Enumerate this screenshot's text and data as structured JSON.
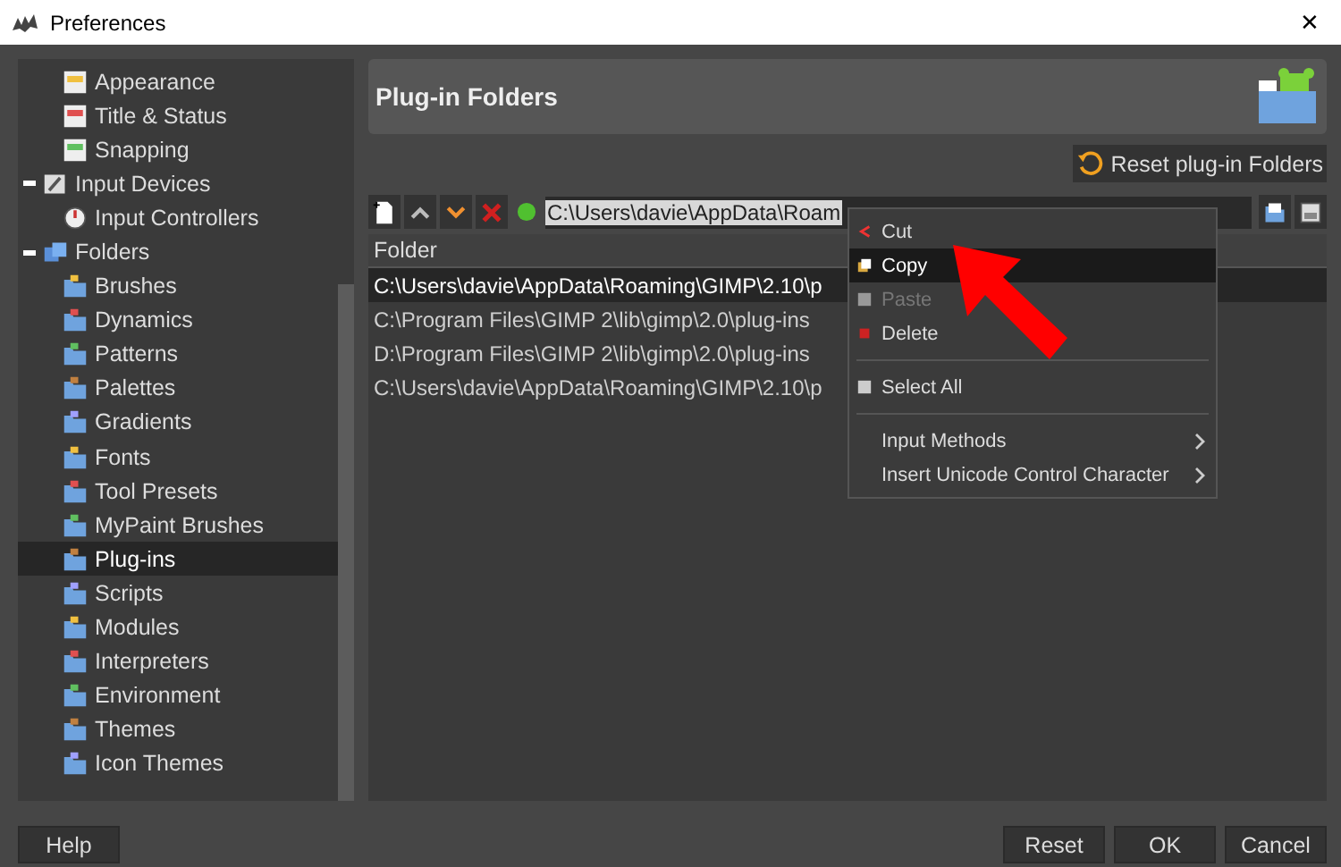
{
  "window": {
    "title": "Preferences",
    "close": "✕"
  },
  "sidebar": {
    "items": [
      {
        "children": [
          {
            "label": "Appearance",
            "selected": false
          },
          {
            "label": "Title & Status",
            "selected": false
          },
          {
            "label": "Snapping",
            "selected": false
          }
        ]
      },
      {
        "label": "Input Devices",
        "expanded": true,
        "selected": false,
        "children": [
          {
            "label": "Input Controllers",
            "selected": false
          }
        ]
      },
      {
        "label": "Folders",
        "expanded": true,
        "selected": false,
        "children": [
          {
            "label": "Brushes",
            "selected": false
          },
          {
            "label": "Dynamics",
            "selected": false
          },
          {
            "label": "Patterns",
            "selected": false
          },
          {
            "label": "Palettes",
            "selected": false
          },
          {
            "label": "Gradients",
            "selected": false
          },
          {
            "label": "Fonts",
            "selected": false
          },
          {
            "label": "Tool Presets",
            "selected": false
          },
          {
            "label": "MyPaint Brushes",
            "selected": false
          },
          {
            "label": "Plug-ins",
            "selected": true
          },
          {
            "label": "Scripts",
            "selected": false
          },
          {
            "label": "Modules",
            "selected": false
          },
          {
            "label": "Interpreters",
            "selected": false
          },
          {
            "label": "Environment",
            "selected": false
          },
          {
            "label": "Themes",
            "selected": false
          },
          {
            "label": "Icon Themes",
            "selected": false
          }
        ]
      }
    ]
  },
  "page": {
    "title": "Plug-in Folders",
    "reset_button": "Reset plug-in Folders",
    "path_field": {
      "value": "C:\\Users\\davie\\AppData\\Roam"
    },
    "table": {
      "columns": [
        "Folder"
      ],
      "rows": [
        {
          "folder": "C:\\Users\\davie\\AppData\\Roaming\\GIMP\\2.10\\p",
          "selected": true
        },
        {
          "folder": "C:\\Program Files\\GIMP 2\\lib\\gimp\\2.0\\plug-ins",
          "selected": false
        },
        {
          "folder": "D:\\Program Files\\GIMP 2\\lib\\gimp\\2.0\\plug-ins",
          "selected": false
        },
        {
          "folder": "C:\\Users\\davie\\AppData\\Roaming\\GIMP\\2.10\\p",
          "selected": false
        }
      ]
    }
  },
  "context_menu": {
    "items": [
      {
        "kind": "item",
        "label": "Cut",
        "selected": false,
        "disabled": false
      },
      {
        "kind": "item",
        "label": "Copy",
        "selected": true,
        "disabled": false
      },
      {
        "kind": "item",
        "label": "Paste",
        "selected": false,
        "disabled": true
      },
      {
        "kind": "item",
        "label": "Delete",
        "selected": false,
        "disabled": false
      },
      {
        "kind": "separator"
      },
      {
        "kind": "item",
        "label": "Select All",
        "selected": false,
        "disabled": false
      },
      {
        "kind": "separator"
      },
      {
        "kind": "item",
        "label": "Input Methods",
        "selected": false,
        "disabled": false,
        "submenu": true
      },
      {
        "kind": "item",
        "label": "Insert Unicode Control Character",
        "selected": false,
        "disabled": false,
        "submenu": true
      }
    ]
  },
  "buttons": {
    "left": [
      "Help"
    ],
    "right": [
      "Reset",
      "OK",
      "Cancel"
    ]
  }
}
